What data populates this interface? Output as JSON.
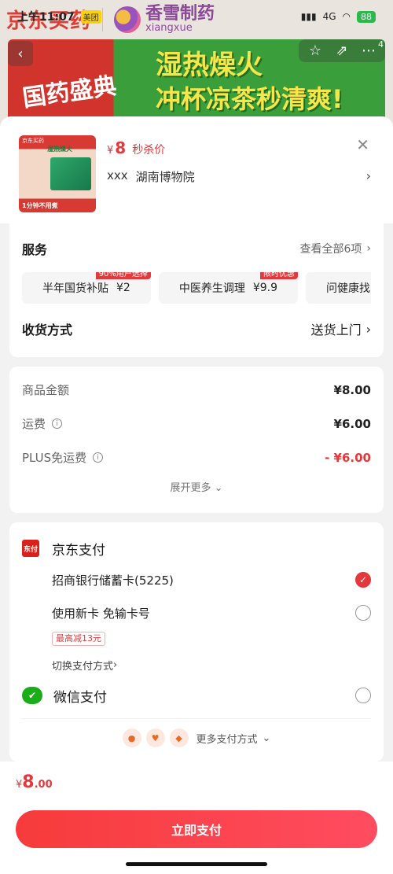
{
  "status_bar": {
    "time": "上午11:07",
    "carrier_tag": "美团",
    "network": "4G",
    "battery": "88"
  },
  "bg_header": {
    "brand_jd": "京东买药",
    "brand_partner_cn": "香雪制药",
    "brand_partner_en": "xiangxue",
    "banner_seal": "国药盛典",
    "banner_slogan_1": "湿热燥火",
    "banner_slogan_2": "冲杯凉茶秒清爽!",
    "cart_badge": "4",
    "icons": [
      "back-icon",
      "star-icon",
      "share-icon",
      "more-icon"
    ]
  },
  "product": {
    "price_currency": "¥",
    "price_value": "8",
    "price_tag": "秒杀价",
    "seller_prefix": "xxx",
    "seller_name": "湖南博物院",
    "thumb_top": "京东买药",
    "thumb_mid": "湿热燥火",
    "thumb_bottom": "1分钟不用煮"
  },
  "services": {
    "title": "服务",
    "view_all": "查看全部6项",
    "chips": [
      {
        "label": "半年国货补贴",
        "price": "¥2",
        "badge": "90%用户选择"
      },
      {
        "label": "中医养生调理",
        "price": "¥9.9",
        "badge": "限时优惠"
      },
      {
        "label": "问健康找医生",
        "price": "",
        "badge": ""
      }
    ],
    "delivery_title": "收货方式",
    "delivery_value": "送货上门"
  },
  "amounts": {
    "rows": [
      {
        "label": "商品金额",
        "value": "¥8.00"
      },
      {
        "label": "运费",
        "value": "¥6.00"
      },
      {
        "label": "PLUS免运费",
        "value": "- ¥6.00"
      }
    ],
    "expand": "展开更多"
  },
  "payment": {
    "jd_pay": "京东支付",
    "jd_icon_text": "东付",
    "option_card": "招商银行储蓄卡(5225)",
    "option_new": "使用新卡 免输卡号",
    "limit_tag": "最高减13元",
    "switch": "切换支付方式",
    "wechat_pay": "微信支付",
    "more": "更多支付方式"
  },
  "footer": {
    "currency": "¥",
    "total_int": "8",
    "total_dec": ".00",
    "pay_button": "立即支付"
  },
  "colors": {
    "accent": "#e4393c",
    "wechat": "#1aad19"
  }
}
